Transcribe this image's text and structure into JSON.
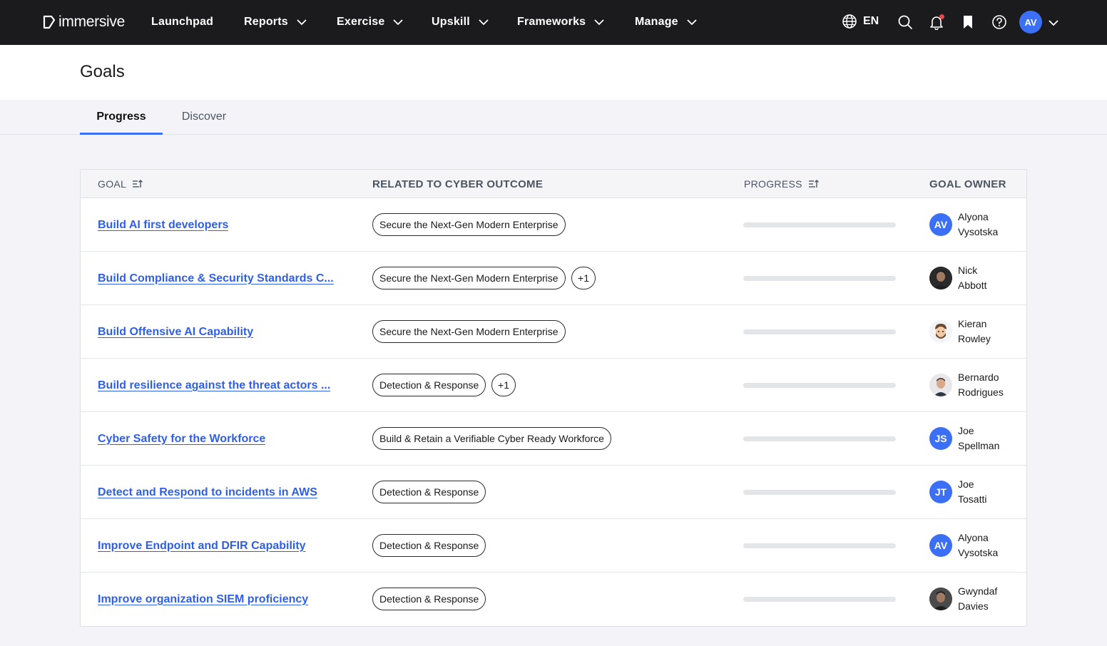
{
  "brand": {
    "name": "immersive",
    "accent": "#3b6ff5"
  },
  "nav": {
    "items": [
      {
        "label": "Launchpad",
        "dropdown": false
      },
      {
        "label": "Reports",
        "dropdown": true
      },
      {
        "label": "Exercise",
        "dropdown": true
      },
      {
        "label": "Upskill",
        "dropdown": true
      },
      {
        "label": "Frameworks",
        "dropdown": true
      },
      {
        "label": "Manage",
        "dropdown": true
      }
    ],
    "language": "EN",
    "user_initials": "AV",
    "icons": [
      "globe-icon",
      "search-icon",
      "bell-icon",
      "bookmark-icon",
      "help-icon",
      "chevron-down-icon"
    ]
  },
  "page": {
    "title": "Goals"
  },
  "tabs": [
    {
      "label": "Progress",
      "active": true
    },
    {
      "label": "Discover",
      "active": false
    }
  ],
  "table": {
    "headers": {
      "goal": "Goal",
      "outcome": "Related to Cyber Outcome",
      "progress": "Progress",
      "owner": "Goal Owner"
    },
    "rows": [
      {
        "goal": "Build AI first developers",
        "outcome": "Secure the Next-Gen Modern Enterprise",
        "extra": "",
        "progress": 0,
        "owner_first": "Alyona",
        "owner_last": "Vysotska",
        "initials": "AV",
        "avatar_color": "#3b6ff5",
        "avatar_type": "initials"
      },
      {
        "goal": "Build Compliance & Security Standards C...",
        "outcome": "Secure the Next-Gen Modern Enterprise",
        "extra": "+1",
        "progress": 0,
        "owner_first": "Nick",
        "owner_last": "Abbott",
        "initials": "",
        "avatar_color": "#2a2a2a",
        "avatar_type": "photo-dark"
      },
      {
        "goal": "Build Offensive AI Capability",
        "outcome": "Secure the Next-Gen Modern Enterprise",
        "extra": "",
        "progress": 0,
        "owner_first": "Kieran",
        "owner_last": "Rowley",
        "initials": "",
        "avatar_color": "#f3f4f6",
        "avatar_type": "illustration"
      },
      {
        "goal": "Build resilience against the threat actors ...",
        "outcome": "Detection & Response",
        "extra": "+1",
        "progress": 0,
        "owner_first": "Bernardo",
        "owner_last": "Rodrigues",
        "initials": "",
        "avatar_color": "#e8e8ea",
        "avatar_type": "photo-light"
      },
      {
        "goal": "Cyber Safety for the Workforce",
        "outcome": "Build & Retain a Verifiable Cyber Ready Workforce",
        "extra": "",
        "progress": 0,
        "owner_first": "Joe",
        "owner_last": "Spellman",
        "initials": "JS",
        "avatar_color": "#3b6ff5",
        "avatar_type": "initials"
      },
      {
        "goal": "Detect and Respond to incidents in AWS",
        "outcome": "Detection & Response",
        "extra": "",
        "progress": 0,
        "owner_first": "Joe",
        "owner_last": "Tosatti",
        "initials": "JT",
        "avatar_color": "#3b6ff5",
        "avatar_type": "initials"
      },
      {
        "goal": "Improve Endpoint and DFIR Capability",
        "outcome": "Detection & Response",
        "extra": "",
        "progress": 0,
        "owner_first": "Alyona",
        "owner_last": "Vysotska",
        "initials": "AV",
        "avatar_color": "#3b6ff5",
        "avatar_type": "initials"
      },
      {
        "goal": "Improve organization SIEM proficiency",
        "outcome": "Detection & Response",
        "extra": "",
        "progress": 0,
        "owner_first": "Gwyndaf",
        "owner_last": "Davies",
        "initials": "",
        "avatar_color": "#4a4a4a",
        "avatar_type": "photo-dark"
      }
    ]
  }
}
